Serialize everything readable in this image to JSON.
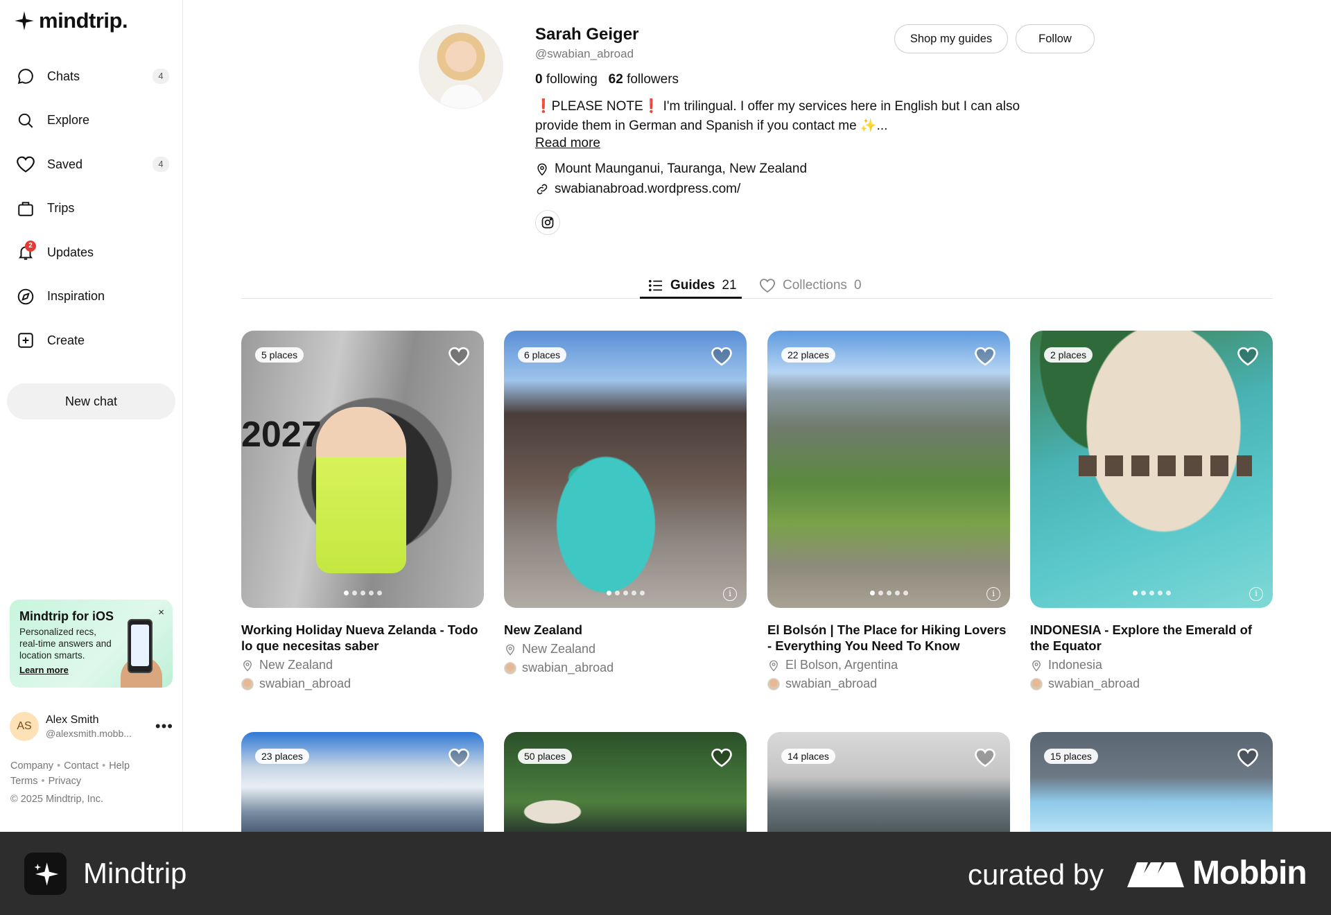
{
  "app": {
    "logo_text": "mindtrip."
  },
  "sidebar": {
    "items": [
      {
        "label": "Chats",
        "count": "4",
        "icon": "chat-icon"
      },
      {
        "label": "Explore",
        "count": "",
        "icon": "search-icon"
      },
      {
        "label": "Saved",
        "count": "4",
        "icon": "heart-icon"
      },
      {
        "label": "Trips",
        "count": "",
        "icon": "bag-icon"
      },
      {
        "label": "Updates",
        "count": "",
        "badge": "2",
        "icon": "bell-icon"
      },
      {
        "label": "Inspiration",
        "count": "",
        "icon": "compass-icon"
      },
      {
        "label": "Create",
        "count": "",
        "icon": "plus-square-icon"
      }
    ],
    "new_chat": "New chat",
    "promo": {
      "title": "Mindtrip for iOS",
      "desc": "Personalized recs, real-time answers and location smarts.",
      "link": "Learn more",
      "close": "×"
    },
    "user": {
      "initials": "AS",
      "name": "Alex Smith",
      "handle": "@alexsmith.mobb..."
    },
    "footer_links": [
      "Company",
      "Contact",
      "Help",
      "Terms",
      "Privacy"
    ],
    "copyright": "© 2025 Mindtrip, Inc."
  },
  "profile": {
    "name": "Sarah Geiger",
    "handle": "@swabian_abroad",
    "following_count": "0",
    "following_label": "following",
    "followers_count": "62",
    "followers_label": "followers",
    "shop_button": "Shop my guides",
    "follow_button": "Follow",
    "bio_warn_mark": "❗",
    "bio_note": "PLEASE NOTE",
    "bio_rest": " I'm trilingual. I offer my services here in English but I can also provide them in German and Spanish if you contact me ✨...",
    "read_more": "Read more",
    "location": "Mount Maunganui, Tauranga, New Zealand",
    "website": "swabianabroad.wordpress.com/"
  },
  "tabs": [
    {
      "label": "Guides",
      "count": "21",
      "active": true
    },
    {
      "label": "Collections",
      "count": "0",
      "active": false
    }
  ],
  "guides": [
    {
      "places": "5 places",
      "title": "Working Holiday Nueva Zelanda - Todo lo que necesitas saber",
      "location": "New Zealand",
      "author": "swabian_abroad"
    },
    {
      "places": "6 places",
      "title": "New Zealand",
      "location": "New Zealand",
      "author": "swabian_abroad"
    },
    {
      "places": "22 places",
      "title": "El Bolsón | The Place for Hiking Lovers - Everything You Need To Know",
      "location": "El Bolson, Argentina",
      "author": "swabian_abroad"
    },
    {
      "places": "2 places",
      "title": "INDONESIA - Explore the Emerald of the Equator",
      "location": "Indonesia",
      "author": "swabian_abroad"
    },
    {
      "places": "23 places"
    },
    {
      "places": "50 places"
    },
    {
      "places": "14 places"
    },
    {
      "places": "15 places"
    }
  ],
  "footer_bar": {
    "app_name": "Mindtrip",
    "curated_by": "curated by",
    "brand": "Mobbin"
  }
}
